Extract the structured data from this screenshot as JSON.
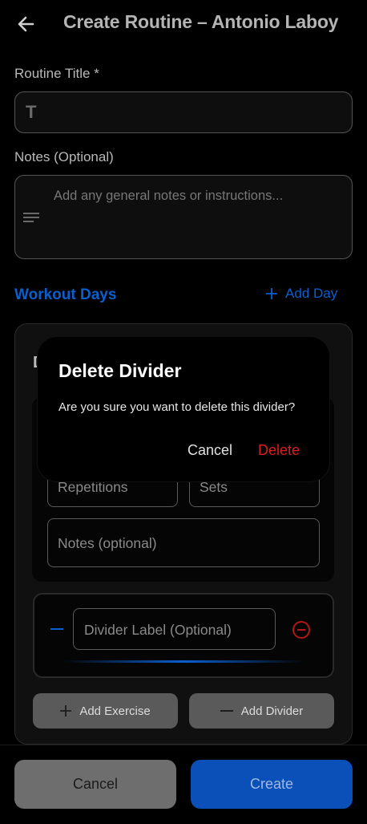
{
  "header": {
    "back_icon": "arrow-left-icon",
    "title": "Create Routine – Antonio Laboy"
  },
  "form": {
    "routine_title_label": "Routine Title *",
    "routine_title_icon": "text-t-icon",
    "routine_title_value": "",
    "notes_label": "Notes (Optional)",
    "notes_icon": "notes-lines-icon",
    "notes_placeholder": "Add any general notes or instructions..."
  },
  "workout_days": {
    "heading": "Workout Days",
    "add_day_label": "Add Day",
    "day_title_fragment": "D",
    "exercise": {
      "repetitions_placeholder": "Repetitions",
      "sets_placeholder": "Sets",
      "notes_placeholder": "Notes (optional)"
    },
    "divider": {
      "label_placeholder": "Divider Label (Optional)",
      "drag_icon": "minus-icon",
      "remove_icon": "remove-circle-icon"
    },
    "add_exercise_label": "Add Exercise",
    "add_divider_label": "Add Divider"
  },
  "footer": {
    "cancel_label": "Cancel",
    "create_label": "Create"
  },
  "dialog": {
    "title": "Delete Divider",
    "message": "Are you sure you want to delete this divider?",
    "cancel_label": "Cancel",
    "delete_label": "Delete"
  },
  "colors": {
    "accent": "#0a5fcf",
    "danger": "#e11a1a",
    "background": "#000000"
  }
}
